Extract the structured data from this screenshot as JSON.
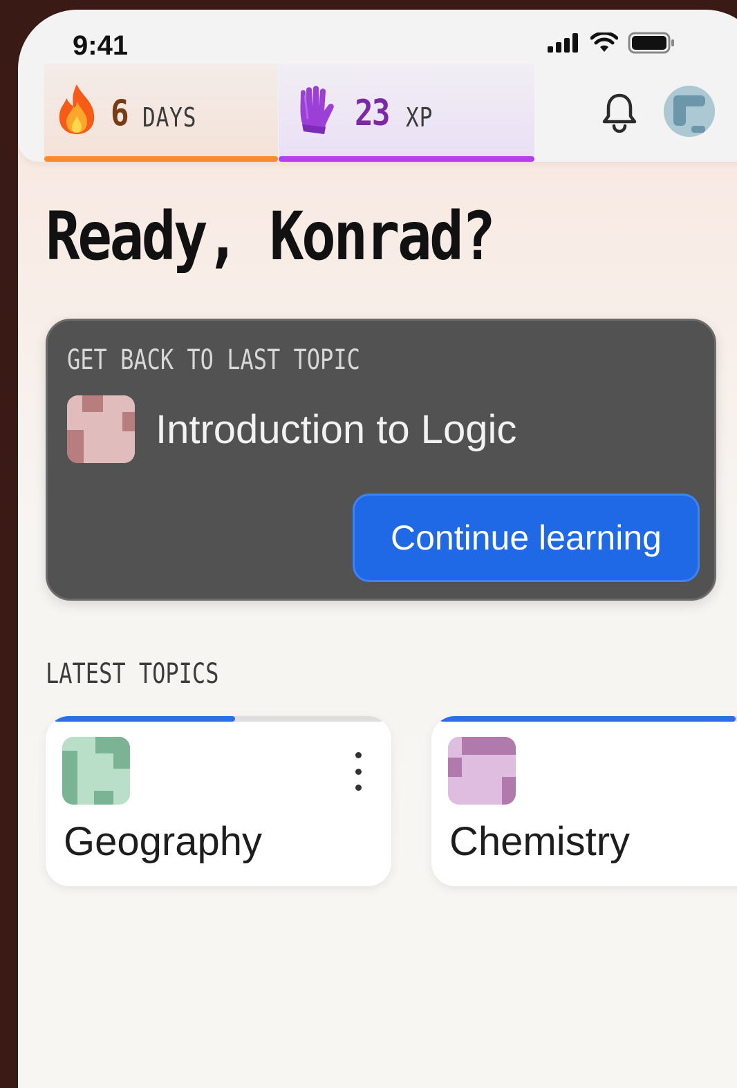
{
  "status_bar": {
    "time": "9:41"
  },
  "stats": {
    "streak": {
      "value": "6",
      "unit": "DAYS",
      "color": "#fb8a2b"
    },
    "xp": {
      "value": "23",
      "unit": "XP",
      "color": "#b43ff0"
    }
  },
  "greeting": "Ready, Konrad?",
  "resume": {
    "eyebrow": "GET BACK TO LAST TOPIC",
    "topic_title": "Introduction to Logic",
    "cta_label": "Continue learning"
  },
  "latest": {
    "label": "LATEST TOPICS",
    "topics": [
      {
        "title": "Geography",
        "progress": 0.55
      },
      {
        "title": "Chemistry",
        "progress": 0.9
      }
    ]
  },
  "colors": {
    "accent": "#1f68e6",
    "streak": "#fb8a2b",
    "xp": "#b43ff0"
  }
}
